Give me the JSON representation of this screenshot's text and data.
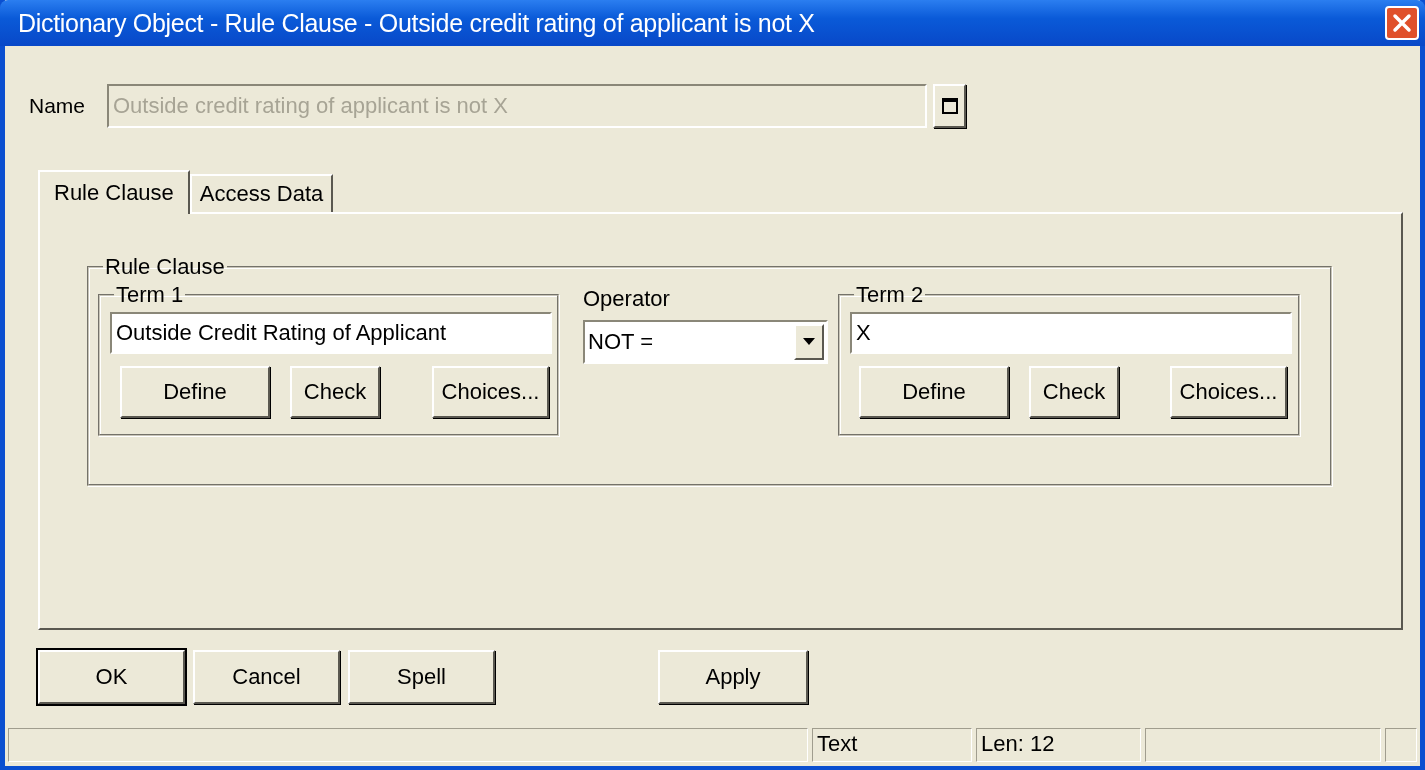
{
  "window": {
    "title": "Dictionary Object - Rule Clause - Outside credit rating of applicant is not X"
  },
  "name_field": {
    "label": "Name",
    "value": "Outside credit rating of applicant is not X",
    "disabled": true
  },
  "tabs": [
    {
      "label": "Rule Clause",
      "selected": true
    },
    {
      "label": "Access Data",
      "selected": false
    }
  ],
  "rule_clause": {
    "title": "Rule Clause",
    "term1": {
      "title": "Term 1",
      "value": "Outside Credit Rating of Applicant",
      "buttons": [
        "Define",
        "Check",
        "Choices..."
      ]
    },
    "operator": {
      "label": "Operator",
      "value": "NOT ="
    },
    "term2": {
      "title": "Term 2",
      "value": "X",
      "buttons": [
        "Define",
        "Check",
        "Choices..."
      ]
    }
  },
  "buttons": [
    {
      "label": "OK",
      "default": true
    },
    {
      "label": "Cancel",
      "default": false
    },
    {
      "label": "Spell",
      "default": false
    },
    {
      "label": "Apply",
      "default": false
    }
  ],
  "status_bar": {
    "panes": [
      "Text",
      "Len: 12"
    ]
  }
}
